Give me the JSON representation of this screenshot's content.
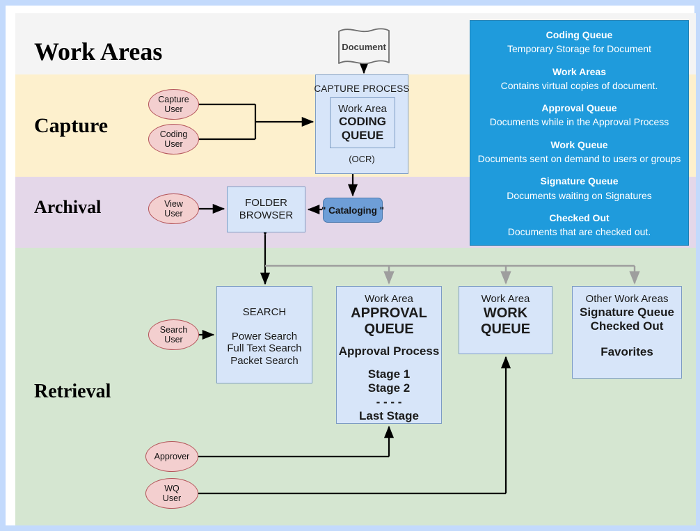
{
  "diagram": {
    "title": "Work Areas",
    "bands": [
      {
        "id": "workareas",
        "label": "Work Areas",
        "color": "#f4f4f4"
      },
      {
        "id": "capture",
        "label": "Capture",
        "color": "#fdf0cd"
      },
      {
        "id": "archival",
        "label": "Archival",
        "color": "#e4d7e9"
      },
      {
        "id": "retrieval",
        "label": "Retrieval",
        "color": "#d5e6d1"
      }
    ]
  },
  "document": {
    "label": "Document"
  },
  "capture_process": {
    "header": "CAPTURE PROCESS",
    "inner_line1": "Work Area",
    "inner_line2": "CODING",
    "inner_line3": "QUEUE",
    "footer": "(OCR)"
  },
  "cataloging": {
    "label": "\" Cataloging \""
  },
  "folder_browser": {
    "line1": "FOLDER",
    "line2": "BROWSER"
  },
  "search_box": {
    "title": "SEARCH",
    "line1": "Power Search",
    "line2": "Full Text Search",
    "line3": "Packet Search"
  },
  "approval_box": {
    "line1": "Work Area",
    "line2": "APPROVAL",
    "line3": "QUEUE",
    "line4": "Approval Process",
    "line5": "Stage 1",
    "line6": "Stage 2",
    "line7": "- - - -",
    "line8": "Last Stage"
  },
  "work_queue_box": {
    "line1": "Work Area",
    "line2": "WORK",
    "line3": "QUEUE"
  },
  "other_box": {
    "line1": "Other Work Areas",
    "line2": "Signature Queue",
    "line3": "Checked Out",
    "line4": "Favorites"
  },
  "actors": [
    {
      "id": "capture-user",
      "line1": "Capture",
      "line2": "User"
    },
    {
      "id": "coding-user",
      "line1": "Coding",
      "line2": "User"
    },
    {
      "id": "view-user",
      "line1": "View",
      "line2": "User"
    },
    {
      "id": "search-user",
      "line1": "Search",
      "line2": "User"
    },
    {
      "id": "approver",
      "line1": "Approver",
      "line2": ""
    },
    {
      "id": "wq-user",
      "line1": "WQ",
      "line2": "User"
    }
  ],
  "legend": {
    "entries": [
      {
        "title": "Coding Queue",
        "desc": "Temporary Storage for Document"
      },
      {
        "title": "Work Areas",
        "desc": "Contains virtual copies of document."
      },
      {
        "title": "Approval Queue",
        "desc": "Documents while in the Approval Process"
      },
      {
        "title": "Work Queue",
        "desc": "Documents sent on demand to users or groups"
      },
      {
        "title": "Signature Queue",
        "desc": "Documents waiting on Signatures"
      },
      {
        "title": "Checked Out",
        "desc": "Documents that are checked out."
      }
    ]
  },
  "colors": {
    "frame": "#c3dafc",
    "band_capture": "#fdf0cd",
    "band_archival": "#e4d7e9",
    "band_retrieval": "#d5e6d1",
    "box_fill": "#d7e5f9",
    "box_stroke": "#7d9cc4",
    "actor_fill": "#f3cfcf",
    "actor_stroke": "#b4555a",
    "legend_fill": "#1f9bdc",
    "cataloging_fill": "#6e9ed7",
    "bus_line": "#9e9e9e"
  }
}
